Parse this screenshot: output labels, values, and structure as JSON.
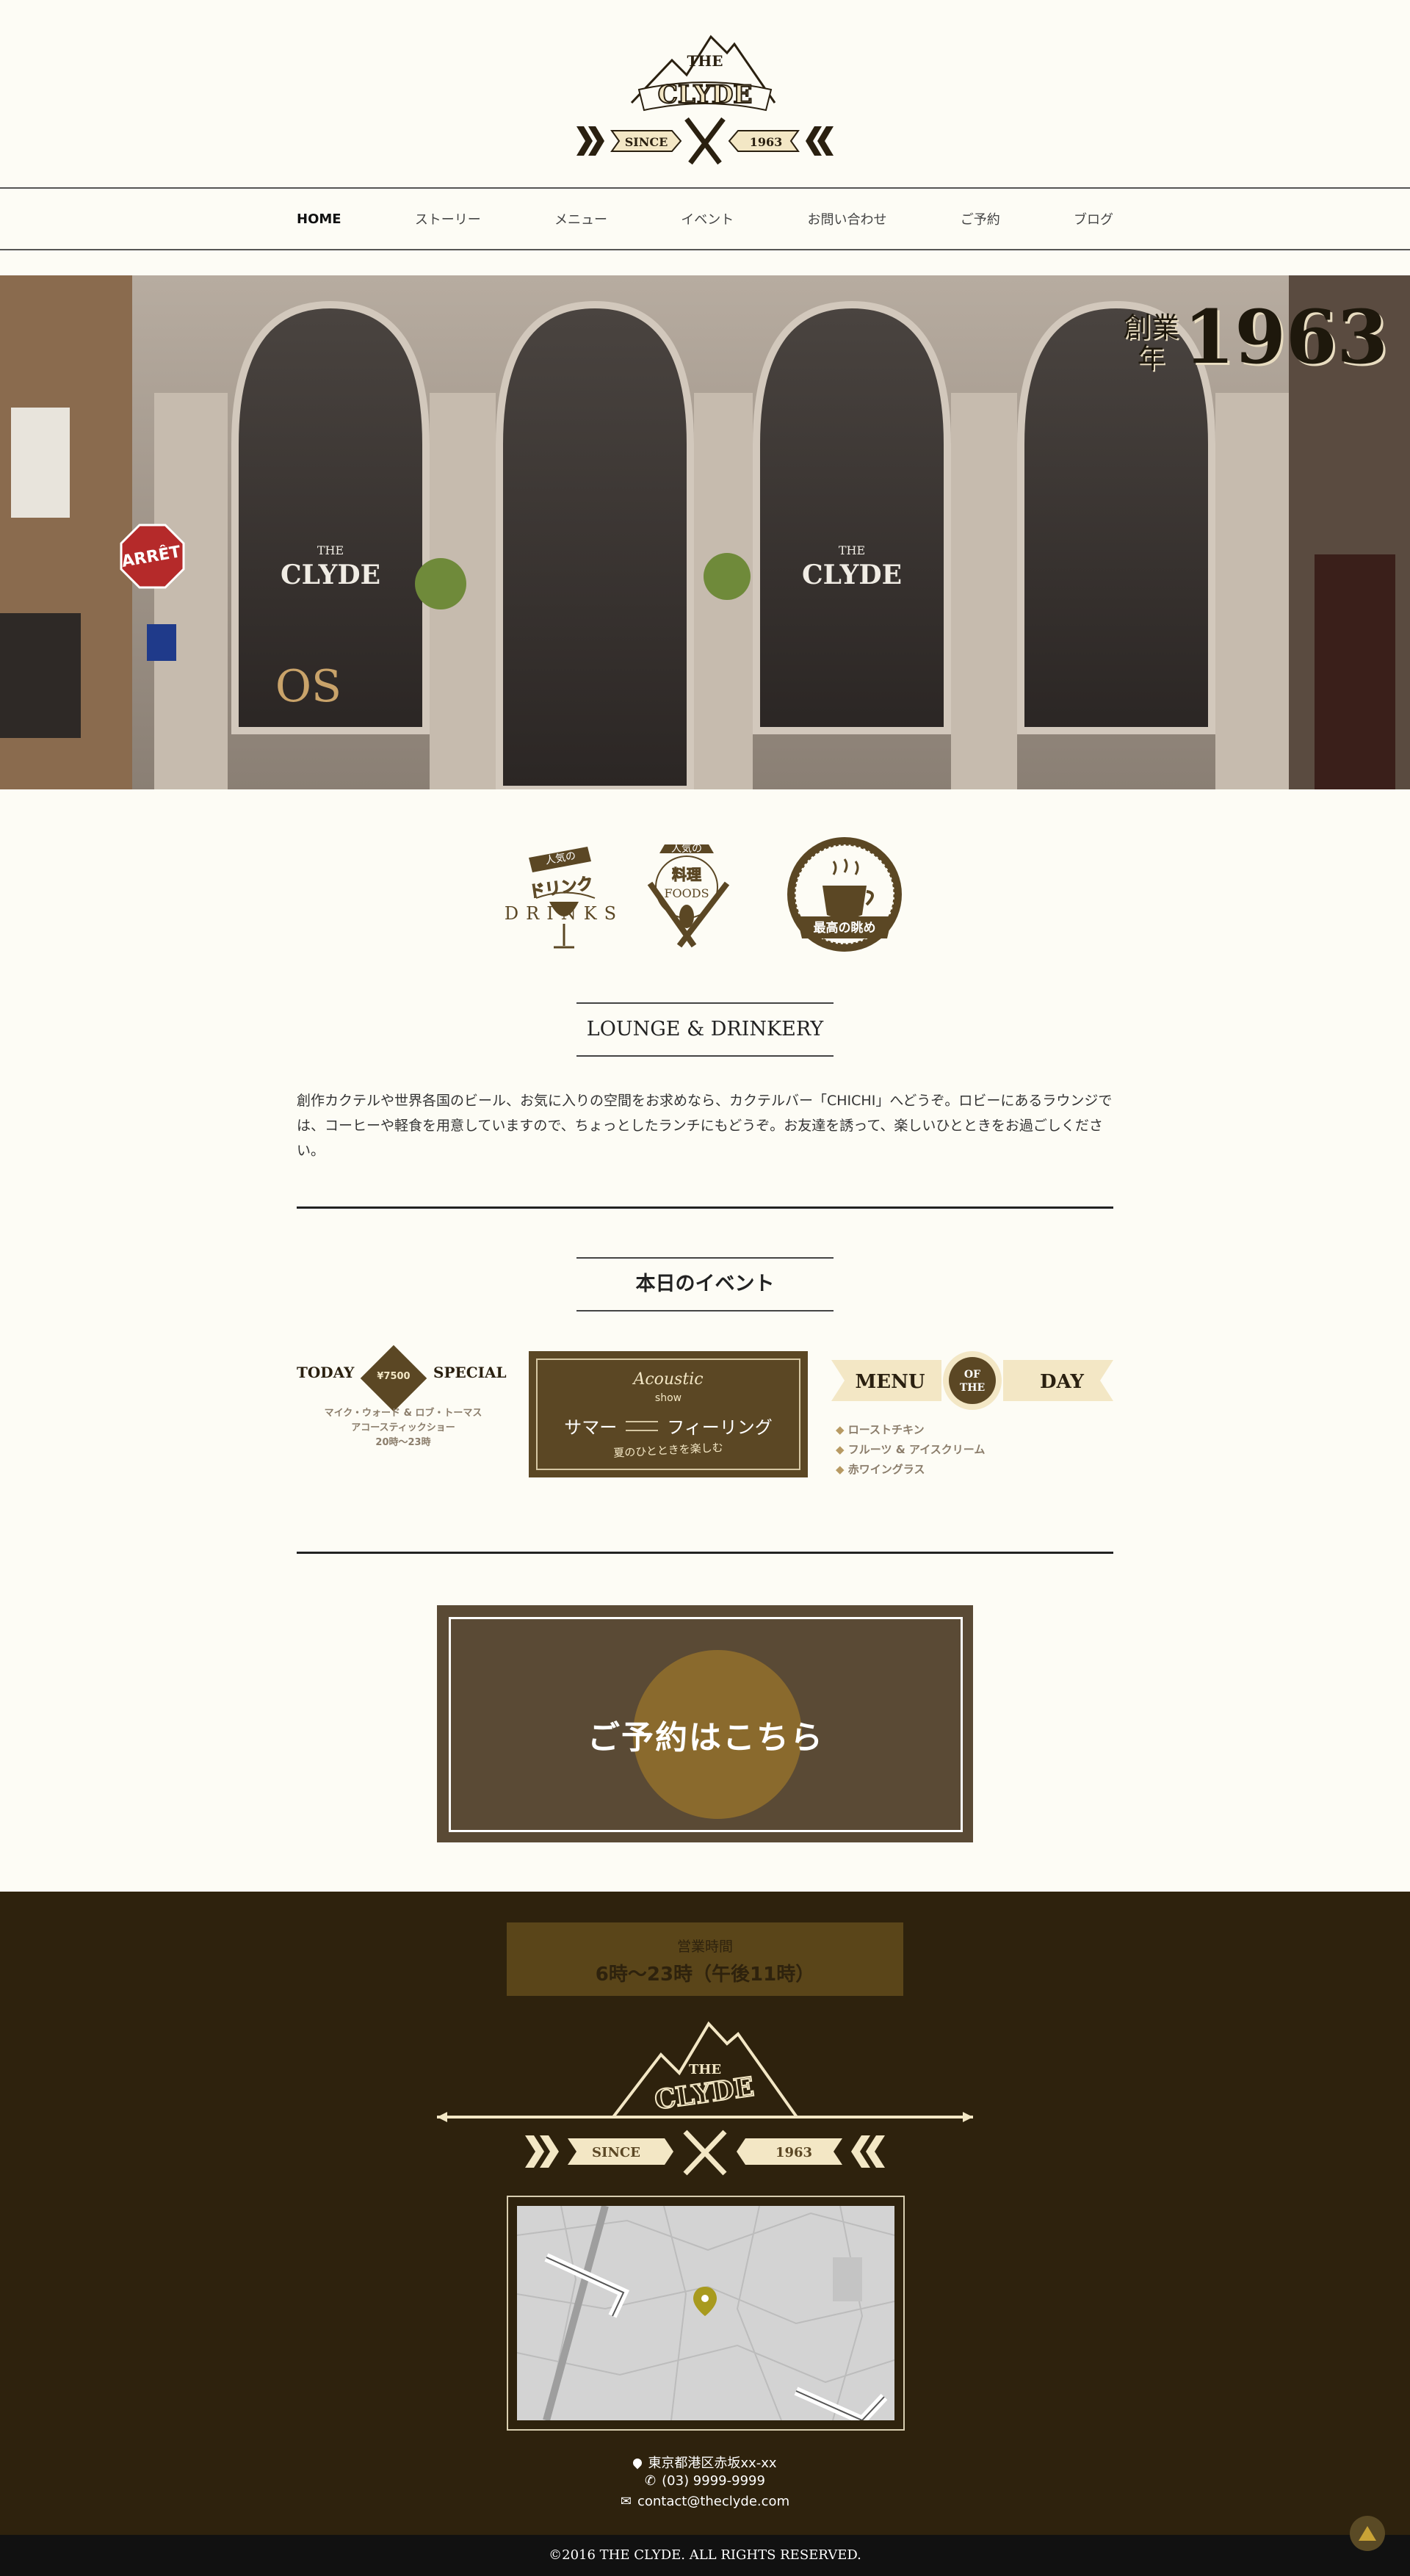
{
  "logo": {
    "the": "THE",
    "name": "CLYDE",
    "since": "SINCE",
    "year": "1963"
  },
  "nav": {
    "items": [
      "HOME",
      "ストーリー",
      "メニュー",
      "イベント",
      "お問い合わせ",
      "ご予約",
      "ブログ"
    ],
    "active": "HOME"
  },
  "hero": {
    "badge_kanji_top": "創業",
    "badge_kanji_bottom": "年",
    "badge_year": "1963",
    "window_sign_the": "THE",
    "window_sign_name": "CLYDE",
    "window_sign_text": "OS",
    "street_sign": "ARRÊT"
  },
  "badges": {
    "drinks_ribbon": "人気の",
    "drinks_jp": "ドリンク",
    "drinks_en": "DRINKS",
    "foods_ribbon": "人気の",
    "foods_jp": "料理",
    "foods_en": "FOODS",
    "view_label": "最高の眺め"
  },
  "lounge": {
    "title": "LOUNGE & DRINKERY",
    "text": "創作カクテルや世界各国のビール、お気に入りの空間をお求めなら、カクテルバー「CHICHI」へどうぞ。ロビーにあるラウンジでは、コーヒーや軽食を用意していますので、ちょっとしたランチにもどうぞ。お友達を誘って、楽しいひとときをお過ごしください。"
  },
  "events": {
    "title": "本日のイベント",
    "today": {
      "left": "TODAY",
      "price": "¥7500",
      "right": "SPECIAL",
      "line1": "マイク・ウォード & ロブ・トーマス",
      "line2": "アコースティックショー",
      "line3": "20時〜23時"
    },
    "acoustic": {
      "script": "Acoustic",
      "show": "show",
      "main_left": "サマー",
      "main_right": "フィーリング",
      "sub": "夏のひとときを楽しむ"
    },
    "motd": {
      "left": "MENU",
      "of": "OF",
      "the": "THE",
      "right": "DAY",
      "items": [
        "ローストチキン",
        "フルーツ & アイスクリーム",
        "赤ワイングラス"
      ]
    }
  },
  "reserve": {
    "label": "ご予約はこちら"
  },
  "footer": {
    "hours_label": "営業時間",
    "hours_value": "6時〜23時（午後11時）",
    "address": "東京都港区赤坂xx-xx",
    "phone": "(03) 9999-9999",
    "email": "contact@theclyde.com",
    "copyright": "©2016 THE CLYDE. ALL RIGHTS RESERVED."
  },
  "colors": {
    "bg": "#fdfcf5",
    "brown": "#5b4724",
    "dark": "#2e220d",
    "accent": "#8a6a2d"
  }
}
